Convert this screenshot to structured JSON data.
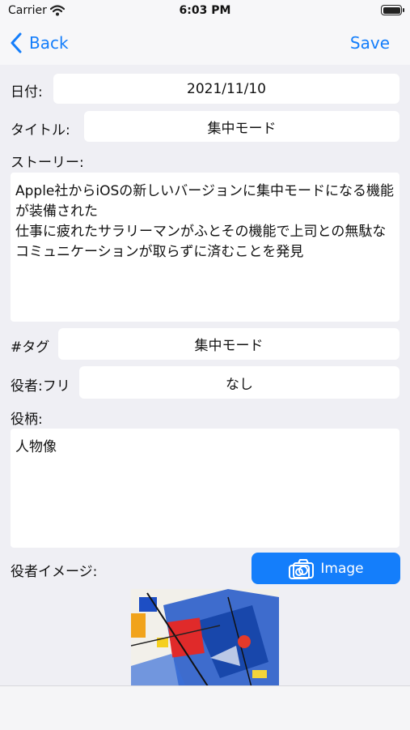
{
  "status": {
    "carrier": "Carrier",
    "time": "6:03 PM"
  },
  "nav": {
    "back_label": "Back",
    "save_label": "Save"
  },
  "form": {
    "date_label": "日付:",
    "date_value": "2021/11/10",
    "title_label": "タイトル:",
    "title_value": "集中モード",
    "story_label": "ストーリー:",
    "story_value": "Apple社からiOSの新しいバージョンに集中モードになる機能が装備された\n仕事に疲れたサラリーマンがふとその機能で上司との無駄なコミュニケーションが取らずに済むことを発見",
    "tag_label": "#タグ",
    "tag_value": "集中モード",
    "actor_label": "役者:フリ",
    "actor_value": "なし",
    "role_label": "役柄:",
    "role_value": "人物像",
    "actor_image_label": "役者イメージ:",
    "image_button_label": "Image"
  },
  "colors": {
    "accent": "#147efb",
    "background": "#efeff4"
  }
}
